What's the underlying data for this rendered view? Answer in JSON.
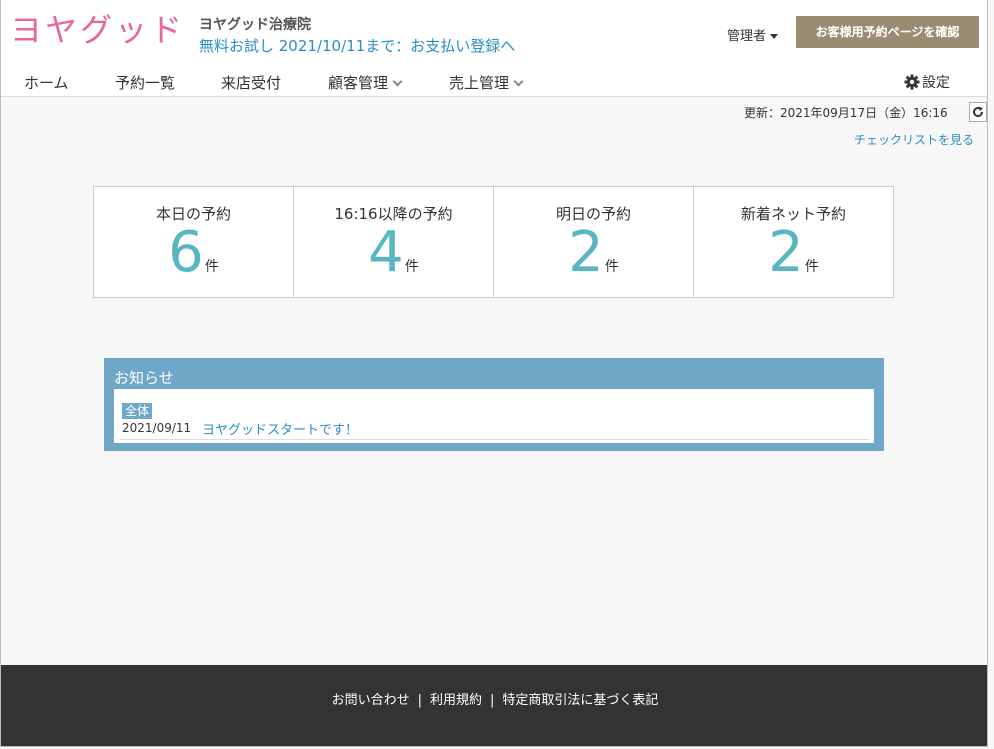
{
  "header": {
    "logo": "ヨヤグッド",
    "clinic_name": "ヨヤグッド治療院",
    "trial_notice": "無料お試し 2021/10/11まで：お支払い登録へ",
    "admin_menu": "管理者",
    "confirm_button": "お客様用予約ページを確認"
  },
  "nav": {
    "items": [
      {
        "label": "ホーム",
        "has_dropdown": false
      },
      {
        "label": "予約一覧",
        "has_dropdown": false
      },
      {
        "label": "来店受付",
        "has_dropdown": false
      },
      {
        "label": "顧客管理",
        "has_dropdown": true
      },
      {
        "label": "売上管理",
        "has_dropdown": true
      }
    ],
    "settings": "設定"
  },
  "status": {
    "updated": "更新：2021年09月17日（金）16:16",
    "checklist_link": "チェックリストを見る"
  },
  "stats": [
    {
      "label": "本日の予約",
      "value": "6",
      "unit": "件"
    },
    {
      "label": "16:16以降の予約",
      "value": "4",
      "unit": "件"
    },
    {
      "label": "明日の予約",
      "value": "2",
      "unit": "件"
    },
    {
      "label": "新着ネット予約",
      "value": "2",
      "unit": "件"
    }
  ],
  "news": {
    "title": "お知らせ",
    "items": [
      {
        "badge": "全体",
        "date": "2021/09/11",
        "text": "ヨヤグッドスタートです！"
      }
    ]
  },
  "footer": {
    "links": [
      "お問い合わせ",
      "利用規約",
      "特定商取引法に基づく表記"
    ],
    "separator": "|"
  },
  "colors": {
    "logo": "#e8649a",
    "link": "#2a8dc5",
    "accent_button": "#9b8b72",
    "stat_number": "#58b5c4",
    "news_panel": "#6fa7c9",
    "footer": "#333333"
  }
}
